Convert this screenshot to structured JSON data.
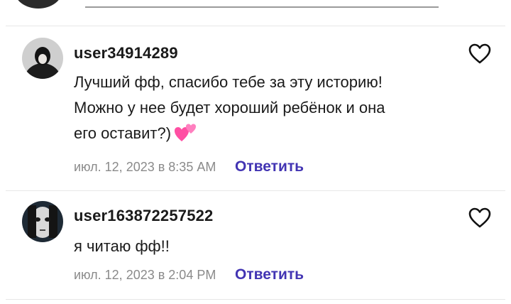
{
  "comments": [
    {
      "username": "user34914289",
      "text_lines": [
        "Лучший фф, спасибо тебе за эту историю!",
        "Можно у нее будет хороший ребёнок и она",
        "его оставит?)"
      ],
      "emoji": "two-hearts",
      "timestamp": "июл. 12, 2023 в 8:35 AM",
      "reply_label": "Ответить"
    },
    {
      "username": "user163872257522",
      "text_lines": [
        "я читаю фф!!"
      ],
      "timestamp": "июл. 12, 2023 в 2:04 PM",
      "reply_label": "Ответить"
    }
  ],
  "colors": {
    "accent": "#4234b3",
    "meta": "#8a8a8a",
    "text": "#1a1a1a"
  }
}
